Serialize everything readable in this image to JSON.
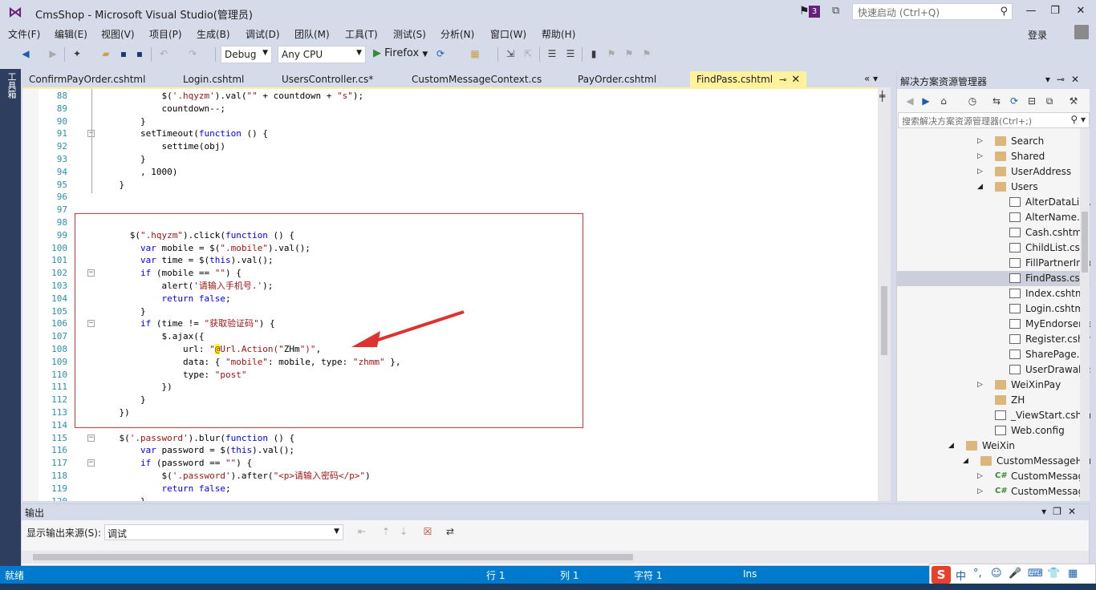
{
  "window": {
    "title": "CmsShop - Microsoft Visual Studio(管理员)",
    "notification_count": "3",
    "quick_launch_placeholder": "快速启动 (Ctrl+Q)",
    "minimize": "—",
    "restore": "❐",
    "close": "✕"
  },
  "menu": {
    "items": [
      "文件(F)",
      "编辑(E)",
      "视图(V)",
      "项目(P)",
      "生成(B)",
      "调试(D)",
      "团队(M)",
      "工具(T)",
      "测试(S)",
      "分析(N)",
      "窗口(W)",
      "帮助(H)"
    ],
    "login": "登录"
  },
  "toolbar": {
    "configuration": "Debug",
    "platform": "Any CPU",
    "run_target": "Firefox"
  },
  "toolbox": {
    "label": "工具箱"
  },
  "tabs": [
    {
      "label": "ConfirmPayOrder.cshtml"
    },
    {
      "label": "Login.cshtml"
    },
    {
      "label": "UsersController.cs*"
    },
    {
      "label": "CustomMessageContext.cs"
    },
    {
      "label": "PayOrder.cshtml"
    },
    {
      "label": "FindPass.cshtml",
      "active": true
    }
  ],
  "editor": {
    "lines": [
      {
        "n": "88",
        "code": "            $('.hqyzm').val(\"\" + countdown + \"s\");"
      },
      {
        "n": "89",
        "code": "            countdown--;"
      },
      {
        "n": "90",
        "code": "        }"
      },
      {
        "n": "91",
        "code": "        setTimeout(function () {",
        "fold": "−"
      },
      {
        "n": "92",
        "code": "            settime(obj)"
      },
      {
        "n": "93",
        "code": "        }"
      },
      {
        "n": "94",
        "code": "        , 1000)"
      },
      {
        "n": "95",
        "code": "    }"
      },
      {
        "n": "96",
        "code": ""
      },
      {
        "n": "97",
        "code": ""
      },
      {
        "n": "98",
        "code": ""
      },
      {
        "n": "99",
        "code": "      $(\".hqyzm\").click(function () {"
      },
      {
        "n": "100",
        "code": "        var mobile = $(\".mobile\").val();"
      },
      {
        "n": "101",
        "code": "        var time = $(this).val();"
      },
      {
        "n": "102",
        "code": "        if (mobile == \"\") {",
        "fold": "−"
      },
      {
        "n": "103",
        "code": "            alert('请输入手机号.');"
      },
      {
        "n": "104",
        "code": "            return false;"
      },
      {
        "n": "105",
        "code": "        }"
      },
      {
        "n": "106",
        "code": "        if (time != \"获取验证码\") {",
        "fold": "−"
      },
      {
        "n": "107",
        "code": "            $.ajax({"
      },
      {
        "n": "108",
        "code": "                url: \"@Url.Action(\"ZHm\")\","
      },
      {
        "n": "109",
        "code": "                data: { \"mobile\": mobile, type: \"zhmm\" },"
      },
      {
        "n": "110",
        "code": "                type: \"post\""
      },
      {
        "n": "111",
        "code": "            })"
      },
      {
        "n": "112",
        "code": "        }"
      },
      {
        "n": "113",
        "code": "    })"
      },
      {
        "n": "114",
        "code": ""
      },
      {
        "n": "115",
        "code": "    $('.password').blur(function () {",
        "fold": "−"
      },
      {
        "n": "116",
        "code": "        var password = $(this).val();"
      },
      {
        "n": "117",
        "code": "        if (password == \"\") {",
        "fold": "−"
      },
      {
        "n": "118",
        "code": "            $('.password').after(\"<p>请输入密码</p>\")"
      },
      {
        "n": "119",
        "code": "            return false;"
      },
      {
        "n": "120",
        "code": "        }"
      }
    ]
  },
  "solution_explorer": {
    "title": "解决方案资源管理器",
    "search_placeholder": "搜索解决方案资源管理器(Ctrl+;)",
    "items": [
      {
        "label": "Search",
        "type": "folder",
        "indent": 1,
        "exp": "▷"
      },
      {
        "label": "Shared",
        "type": "folder",
        "indent": 1,
        "exp": "▷"
      },
      {
        "label": "UserAddress",
        "type": "folder",
        "indent": 1,
        "exp": "▷"
      },
      {
        "label": "Users",
        "type": "folder",
        "indent": 1,
        "exp": "◢"
      },
      {
        "label": "AlterDataList.c",
        "type": "file",
        "indent": 2
      },
      {
        "label": "AlterName.csh",
        "type": "file",
        "indent": 2
      },
      {
        "label": "Cash.cshtml",
        "type": "file",
        "indent": 2
      },
      {
        "label": "ChildList.cshtm",
        "type": "file",
        "indent": 2
      },
      {
        "label": "FillPartnerInfo.",
        "type": "file",
        "indent": 2
      },
      {
        "label": "FindPass.cshtm",
        "type": "file",
        "indent": 2,
        "selected": true
      },
      {
        "label": "Index.cshtml",
        "type": "file",
        "indent": 2
      },
      {
        "label": "Login.cshtml",
        "type": "file",
        "indent": 2
      },
      {
        "label": "MyEndorseme",
        "type": "file",
        "indent": 2
      },
      {
        "label": "Register.cshtm",
        "type": "file",
        "indent": 2
      },
      {
        "label": "SharePage.csh",
        "type": "file",
        "indent": 2
      },
      {
        "label": "UserDrawal.cs",
        "type": "file",
        "indent": 2
      },
      {
        "label": "WeiXinPay",
        "type": "folder",
        "indent": 1,
        "exp": "▷"
      },
      {
        "label": "ZH",
        "type": "folder",
        "indent": 1
      },
      {
        "label": "_ViewStart.cshtml",
        "type": "file",
        "indent": 1
      },
      {
        "label": "Web.config",
        "type": "config",
        "indent": 1
      },
      {
        "label": "WeiXin",
        "type": "folder",
        "indent": -1,
        "exp": "◢"
      },
      {
        "label": "CustomMessageHan",
        "type": "folder",
        "indent": 0,
        "exp": "◢"
      },
      {
        "label": "CustomMessageC",
        "type": "cs",
        "indent": 1,
        "exp": "▷"
      },
      {
        "label": "CustomMessageH",
        "type": "cs",
        "indent": 1,
        "exp": "▷"
      }
    ]
  },
  "output": {
    "title": "输出",
    "source_label": "显示输出来源(S):",
    "source_value": "调试"
  },
  "status": {
    "ready": "就绪",
    "row": "行 1",
    "col": "列 1",
    "char": "字符 1",
    "mode": "Ins"
  },
  "ime": {
    "logo": "S",
    "items": [
      "中",
      "°,",
      "☺",
      "🎤",
      "⌨",
      "👕",
      "▦"
    ]
  },
  "colors": {
    "accent": "#68217A",
    "status_bar": "#007ACC",
    "active_tab": "#FFF29D",
    "highlight_box": "#E03131"
  }
}
